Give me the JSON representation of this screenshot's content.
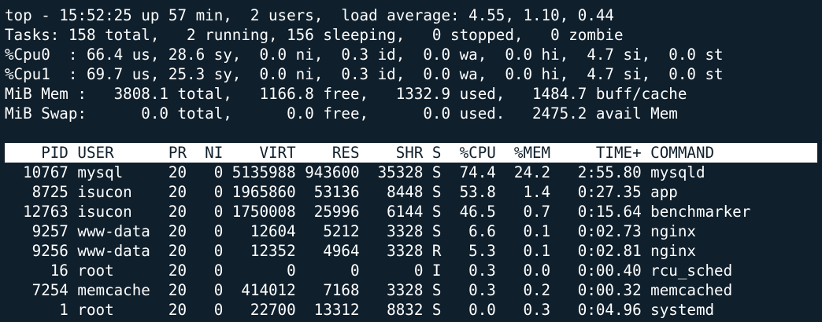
{
  "summary": [
    "top - 15:52:25 up 57 min,  2 users,  load average: 4.55, 1.10, 0.44",
    "Tasks: 158 total,   2 running, 156 sleeping,   0 stopped,   0 zombie",
    "%Cpu0  : 66.4 us, 28.6 sy,  0.0 ni,  0.3 id,  0.0 wa,  0.0 hi,  4.7 si,  0.0 st",
    "%Cpu1  : 69.7 us, 25.3 sy,  0.0 ni,  0.3 id,  0.0 wa,  0.0 hi,  4.7 si,  0.0 st",
    "MiB Mem :   3808.1 total,   1166.8 free,   1332.9 used,   1484.7 buff/cache",
    "MiB Swap:      0.0 total,      0.0 free,      0.0 used.   2475.2 avail Mem"
  ],
  "process_table": {
    "header": "    PID USER      PR  NI    VIRT    RES    SHR S  %CPU  %MEM     TIME+ COMMAND",
    "rows": [
      "  10767 mysql     20   0 5135988 943600  35328 S  74.4  24.2   2:55.80 mysqld",
      "   8725 isucon    20   0 1965860  53136   8448 S  53.8   1.4   0:27.35 app",
      "  12763 isucon    20   0 1750008  25996   6144 S  46.5   0.7   0:15.64 benchmarker",
      "   9257 www-data  20   0   12604   5212   3328 S   6.6   0.1   0:02.73 nginx",
      "   9256 www-data  20   0   12352   4964   3328 R   5.3   0.1   0:02.81 nginx",
      "     16 root      20   0       0      0      0 I   0.3   0.0   0:00.40 rcu_sched",
      "   7254 memcache  20   0  414012   7168   3328 S   0.3   0.2   0:00.32 memcached",
      "      1 root      20   0   22700  13312   8832 S   0.0   0.3   0:04.96 systemd"
    ]
  },
  "colors": {
    "background": "#0f1f2c",
    "foreground": "#ffffff"
  }
}
